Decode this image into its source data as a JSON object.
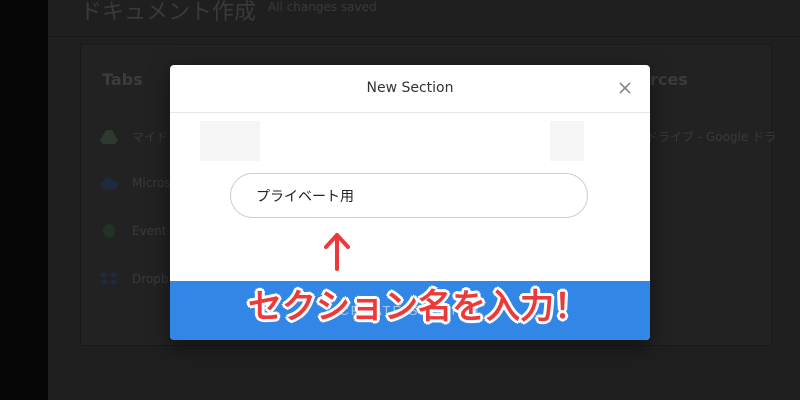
{
  "background_app": {
    "doc_title": "ドキュメント作成",
    "status": "All changes saved",
    "tabs_heading": "Tabs",
    "sources_heading": "rces",
    "tabs": [
      {
        "label": "マイド",
        "icon": "google-drive-icon"
      },
      {
        "label": "Micros",
        "icon": "onedrive-icon"
      },
      {
        "label": "Event",
        "icon": "evernote-icon"
      },
      {
        "label": "Dropb",
        "icon": "dropbox-icon"
      }
    ],
    "source_item": "イドライブ - Google ドラ"
  },
  "modal": {
    "title": "New Section",
    "input_value": "プライベート用",
    "create_label": "CREATE SECTION"
  },
  "annotation": {
    "text": "セクション名を入力！",
    "color": "#ec3a3a"
  },
  "colors": {
    "accent": "#3286e6"
  }
}
